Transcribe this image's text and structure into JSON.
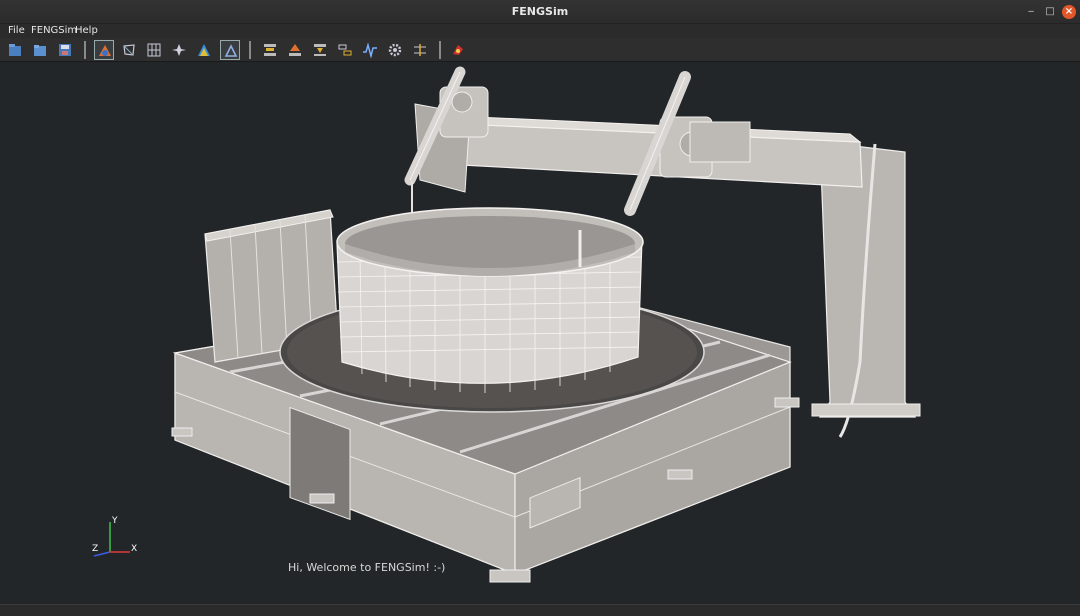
{
  "window": {
    "title": "FENGSim",
    "minimize_glyph": "‒",
    "restore_glyph": "□",
    "close_glyph": "×"
  },
  "menu": {
    "file": "File",
    "fengsim": "FENGSim",
    "help": "Help"
  },
  "toolbar": {
    "icons": [
      "new-project-icon",
      "open-folder-icon",
      "save-icon",
      "geometry-module-icon",
      "mesh-module-icon",
      "mesh-grid-icon",
      "solver-icon",
      "visualization-icon",
      "annotation-icon",
      "additive-manufacturing-icon",
      "layer-slice-icon",
      "path-planning-icon",
      "measurement-icon",
      "signal-icon",
      "settings-icon",
      "tolerance-icon",
      "robot-icon"
    ]
  },
  "viewport": {
    "background": "#222628",
    "welcome_message": "Hi, Welcome to FENGSim! :-)",
    "axis_labels": {
      "x": "X",
      "y": "Y",
      "z": "Z"
    },
    "axis_colors": {
      "x": "#e03a3a",
      "y": "#3cc44a",
      "z": "#3a5ee0"
    }
  }
}
